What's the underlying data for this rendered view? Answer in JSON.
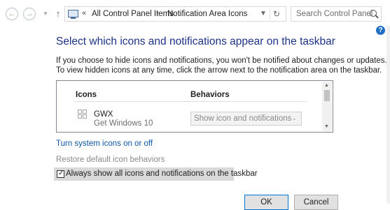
{
  "nav": {
    "address": {
      "separator_0": "«",
      "crumb_1": "All Control Panel Items",
      "separator_1": "›",
      "crumb_2": "Notification Area Icons"
    },
    "search": {
      "placeholder": "Search Control Panel"
    }
  },
  "main": {
    "title": "Select which icons and notifications appear on the taskbar",
    "description_line1": "If you choose to hide icons and notifications, you won't be notified about changes or updates.",
    "description_line2": "To view hidden icons at any time, click the arrow next to the notification area on the taskbar.",
    "table": {
      "headers": {
        "icons": "Icons",
        "behaviors": "Behaviors"
      },
      "rows": [
        {
          "name": "GWX",
          "description": "Get Windows 10",
          "behavior": "Show icon and notifications",
          "icon": "windows-logo-icon"
        }
      ]
    },
    "links": {
      "system_icons": "Turn system icons on or off",
      "restore_defaults": "Restore default icon behaviors"
    },
    "always_show": {
      "label": "Always show all icons and notifications on the taskbar",
      "checked": true
    }
  },
  "footer": {
    "ok_label": "OK",
    "cancel_label": "Cancel"
  },
  "colors": {
    "title": "#1e3287",
    "link": "#0b55a8",
    "help": "#1f6fc5"
  }
}
